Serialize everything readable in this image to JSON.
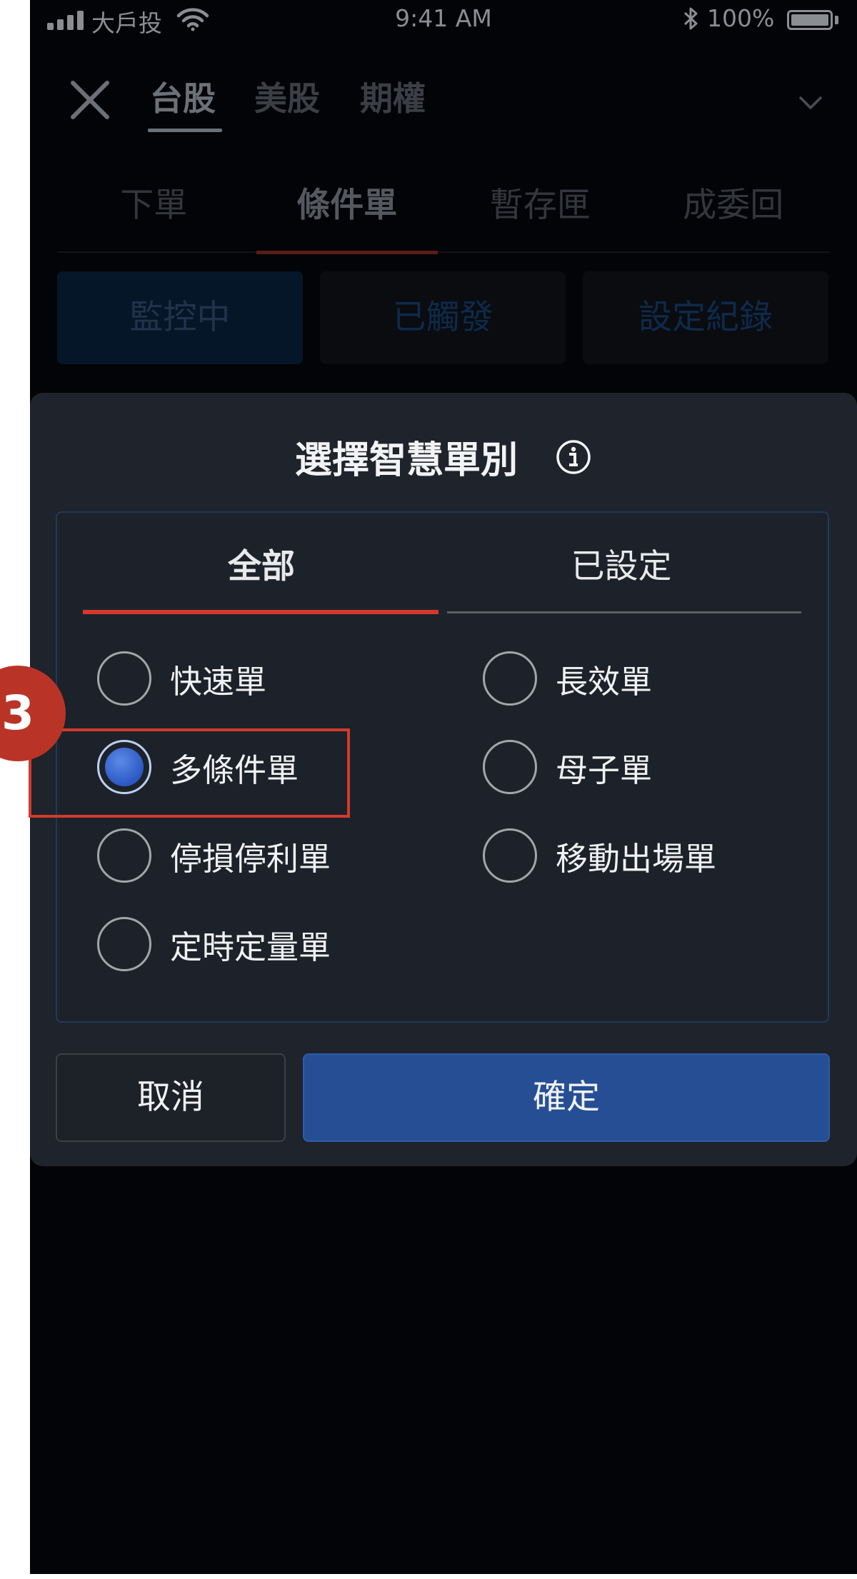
{
  "status_bar": {
    "carrier": "大戶投",
    "time": "9:41 AM",
    "battery": "100%"
  },
  "market_tabs": [
    "台股",
    "美股",
    "期權"
  ],
  "order_tabs": [
    "下單",
    "條件單",
    "暫存匣",
    "成委回"
  ],
  "sub_tabs": [
    "監控中",
    "已觸發",
    "設定紀錄"
  ],
  "modal": {
    "title": "選擇智慧單別",
    "tabs": [
      "全部",
      "已設定"
    ],
    "options_left": [
      "快速單",
      "多條件單",
      "停損停利單",
      "定時定量單"
    ],
    "options_right": [
      "長效單",
      "母子單",
      "移動出場單"
    ],
    "selected": "多條件單",
    "cancel_label": "取消",
    "confirm_label": "確定"
  },
  "annotation": {
    "step": "3"
  },
  "colors": {
    "accent_red": "#d6382b",
    "confirm_blue": "#264e94",
    "background": "#030407",
    "modal": "#1f232b"
  },
  "icons": [
    "signal-icon",
    "wifi-icon",
    "bluetooth-icon",
    "battery-icon",
    "close-icon",
    "chevron-down-icon",
    "info-icon"
  ]
}
